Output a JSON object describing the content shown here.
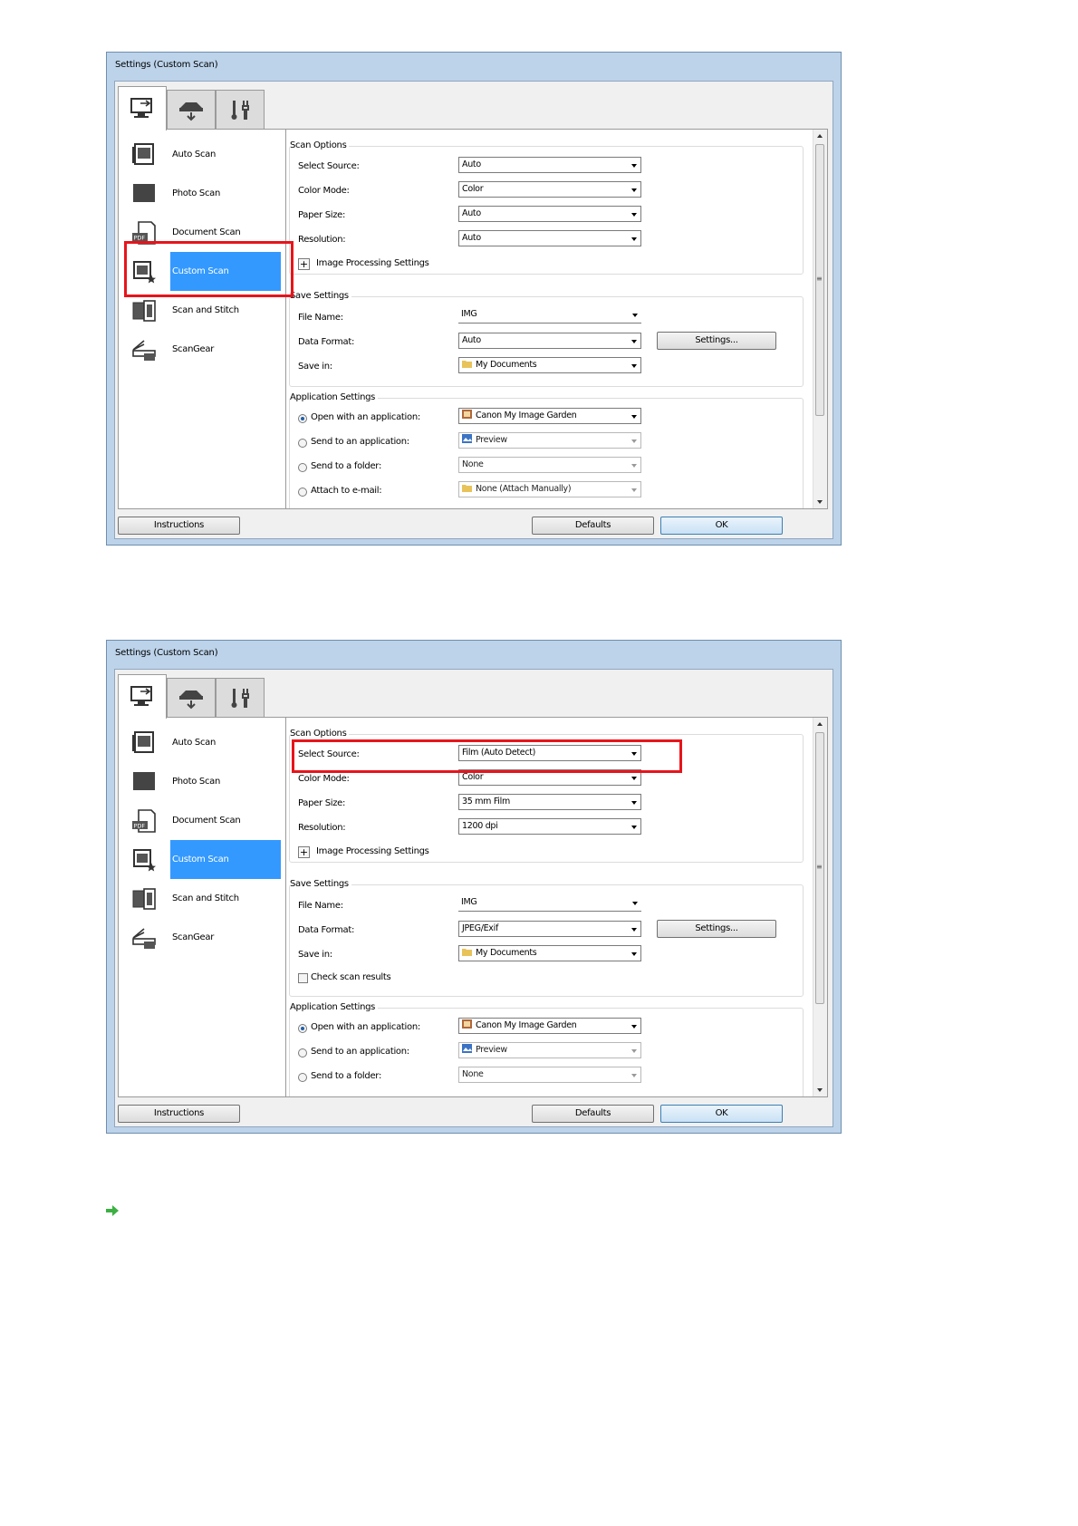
{
  "colors": {
    "dialog_frame": "#bcd3ea",
    "selection": "#3399ff",
    "highlight": "#e8141b",
    "arrow": "#3cb043"
  },
  "dialogs": [
    {
      "title": "Settings (Custom Scan)",
      "tabs": [
        "scan-from-computer-icon",
        "scan-from-operation-panel-icon",
        "general-settings-icon"
      ],
      "nav": [
        "Auto Scan",
        "Photo Scan",
        "Document Scan",
        "Custom Scan",
        "Scan and Stitch",
        "ScanGear"
      ],
      "selected_nav": "Custom Scan",
      "scan_options": {
        "title": "Scan Options",
        "select_source_label": "Select Source:",
        "select_source": "Auto",
        "color_mode_label": "Color Mode:",
        "color_mode": "Color",
        "paper_size_label": "Paper Size:",
        "paper_size": "Auto",
        "resolution_label": "Resolution:",
        "resolution": "Auto",
        "image_processing": "Image Processing Settings"
      },
      "save_settings": {
        "title": "Save Settings",
        "file_name_label": "File Name:",
        "file_name": "IMG",
        "data_format_label": "Data Format:",
        "data_format": "Auto",
        "settings_button": "Settings...",
        "save_in_label": "Save in:",
        "save_in": "My Documents"
      },
      "application_settings": {
        "title": "Application Settings",
        "open_label": "Open with an application:",
        "open_value": "Canon My Image Garden",
        "send_app_label": "Send to an application:",
        "send_app_value": "Preview",
        "send_folder_label": "Send to a folder:",
        "send_folder_value": "None",
        "attach_label": "Attach to e-mail:",
        "attach_value": "None (Attach Manually)"
      },
      "buttons": {
        "instructions": "Instructions",
        "defaults": "Defaults",
        "ok": "OK"
      }
    },
    {
      "title": "Settings (Custom Scan)",
      "nav": [
        "Auto Scan",
        "Photo Scan",
        "Document Scan",
        "Custom Scan",
        "Scan and Stitch",
        "ScanGear"
      ],
      "selected_nav": "Custom Scan",
      "scan_options": {
        "title": "Scan Options",
        "select_source_label": "Select Source:",
        "select_source": "Film (Auto Detect)",
        "color_mode_label": "Color Mode:",
        "color_mode": "Color",
        "paper_size_label": "Paper Size:",
        "paper_size": "35 mm Film",
        "resolution_label": "Resolution:",
        "resolution": "1200 dpi",
        "image_processing": "Image Processing Settings"
      },
      "save_settings": {
        "title": "Save Settings",
        "file_name_label": "File Name:",
        "file_name": "IMG",
        "data_format_label": "Data Format:",
        "data_format": "JPEG/Exif",
        "settings_button": "Settings...",
        "save_in_label": "Save in:",
        "save_in": "My Documents",
        "check_scan_results": "Check scan results"
      },
      "application_settings": {
        "title": "Application Settings",
        "open_label": "Open with an application:",
        "open_value": "Canon My Image Garden",
        "send_app_label": "Send to an application:",
        "send_app_value": "Preview",
        "send_folder_label": "Send to a folder:",
        "send_folder_value": "None"
      },
      "buttons": {
        "instructions": "Instructions",
        "defaults": "Defaults",
        "ok": "OK"
      }
    }
  ]
}
